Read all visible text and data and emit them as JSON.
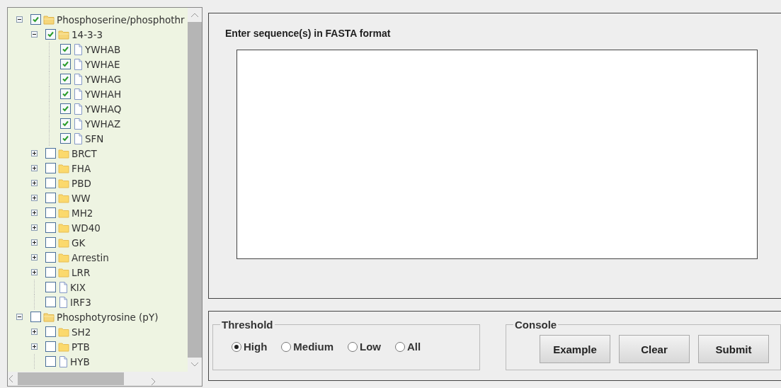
{
  "tree": [
    {
      "label": "Phosphoserine/phosphothr",
      "kind": "folder",
      "expanded": true,
      "checked": true,
      "children": [
        {
          "label": "14-3-3",
          "kind": "folder",
          "expanded": true,
          "checked": true,
          "children": [
            {
              "label": "YWHAB",
              "kind": "file",
              "checked": true
            },
            {
              "label": "YWHAE",
              "kind": "file",
              "checked": true
            },
            {
              "label": "YWHAG",
              "kind": "file",
              "checked": true
            },
            {
              "label": "YWHAH",
              "kind": "file",
              "checked": true
            },
            {
              "label": "YWHAQ",
              "kind": "file",
              "checked": true
            },
            {
              "label": "YWHAZ",
              "kind": "file",
              "checked": true
            },
            {
              "label": "SFN",
              "kind": "file",
              "checked": true
            }
          ]
        },
        {
          "label": "BRCT",
          "kind": "folder",
          "expanded": false,
          "checked": false
        },
        {
          "label": "FHA",
          "kind": "folder",
          "expanded": false,
          "checked": false
        },
        {
          "label": "PBD",
          "kind": "folder",
          "expanded": false,
          "checked": false
        },
        {
          "label": "WW",
          "kind": "folder",
          "expanded": false,
          "checked": false
        },
        {
          "label": "MH2",
          "kind": "folder",
          "expanded": false,
          "checked": false
        },
        {
          "label": "WD40",
          "kind": "folder",
          "expanded": false,
          "checked": false
        },
        {
          "label": "GK",
          "kind": "folder",
          "expanded": false,
          "checked": false
        },
        {
          "label": "Arrestin",
          "kind": "folder",
          "expanded": false,
          "checked": false
        },
        {
          "label": "LRR",
          "kind": "folder",
          "expanded": false,
          "checked": false
        },
        {
          "label": "KIX",
          "kind": "file",
          "checked": false
        },
        {
          "label": "IRF3",
          "kind": "file",
          "checked": false
        }
      ]
    },
    {
      "label": "Phosphotyrosine (pY)",
      "kind": "folder",
      "expanded": true,
      "checked": false,
      "children": [
        {
          "label": "SH2",
          "kind": "folder",
          "expanded": false,
          "checked": false
        },
        {
          "label": "PTB",
          "kind": "folder",
          "expanded": false,
          "checked": false
        },
        {
          "label": "HYB",
          "kind": "file",
          "checked": false
        }
      ]
    }
  ],
  "sequence": {
    "label": "Enter sequence(s) in FASTA format"
  },
  "threshold": {
    "legend": "Threshold",
    "options": [
      {
        "label": "High",
        "selected": true
      },
      {
        "label": "Medium",
        "selected": false
      },
      {
        "label": "Low",
        "selected": false
      },
      {
        "label": "All",
        "selected": false
      }
    ]
  },
  "console": {
    "legend": "Console",
    "buttons": [
      "Example",
      "Clear",
      "Submit"
    ]
  }
}
